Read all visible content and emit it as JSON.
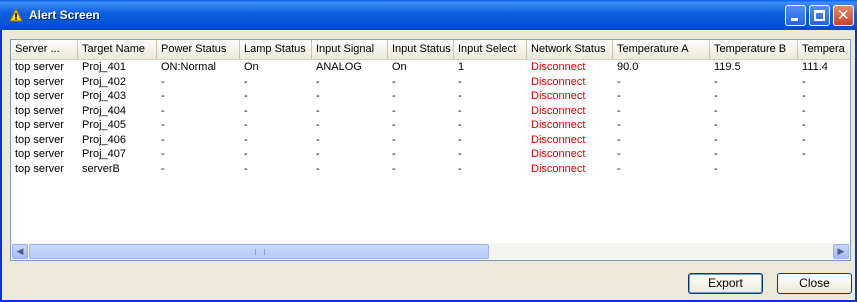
{
  "window": {
    "title": "Alert Screen",
    "icons": {
      "title": "warning-triangle-icon",
      "minimize": "minimize-icon",
      "maximize": "maximize-icon",
      "close": "close-icon"
    },
    "close_glyph": "✕"
  },
  "table": {
    "columns": [
      "Server ...",
      "Target Name",
      "Power Status",
      "Lamp Status",
      "Input Signal",
      "Input Status",
      "Input Select",
      "Network Status",
      "Temperature A",
      "Temperature B",
      "Tempera"
    ],
    "rows": [
      [
        "top server",
        "Proj_401",
        "ON:Normal",
        "On",
        "ANALOG",
        "On",
        "1",
        "Disconnect",
        "90.0",
        "119.5",
        "111.4"
      ],
      [
        "top server",
        "Proj_402",
        "-",
        "-",
        "-",
        "-",
        "-",
        "Disconnect",
        "-",
        "-",
        "-"
      ],
      [
        "top server",
        "Proj_403",
        "-",
        "-",
        "-",
        "-",
        "-",
        "Disconnect",
        "-",
        "-",
        "-"
      ],
      [
        "top server",
        "Proj_404",
        "-",
        "-",
        "-",
        "-",
        "-",
        "Disconnect",
        "-",
        "-",
        "-"
      ],
      [
        "top server",
        "Proj_405",
        "-",
        "-",
        "-",
        "-",
        "-",
        "Disconnect",
        "-",
        "-",
        "-"
      ],
      [
        "top server",
        "Proj_406",
        "-",
        "-",
        "-",
        "-",
        "-",
        "Disconnect",
        "-",
        "-",
        "-"
      ],
      [
        "top server",
        "Proj_407",
        "-",
        "-",
        "-",
        "-",
        "-",
        "Disconnect",
        "-",
        "-",
        "-"
      ],
      [
        "top server",
        "serverB",
        "-",
        "-",
        "-",
        "-",
        "-",
        "Disconnect",
        "-",
        "-",
        ""
      ]
    ],
    "status_color": "#e00000"
  },
  "scrollbar": {
    "left_arrow": "◀",
    "right_arrow": "▶"
  },
  "buttons": {
    "export": "Export",
    "close": "Close"
  }
}
